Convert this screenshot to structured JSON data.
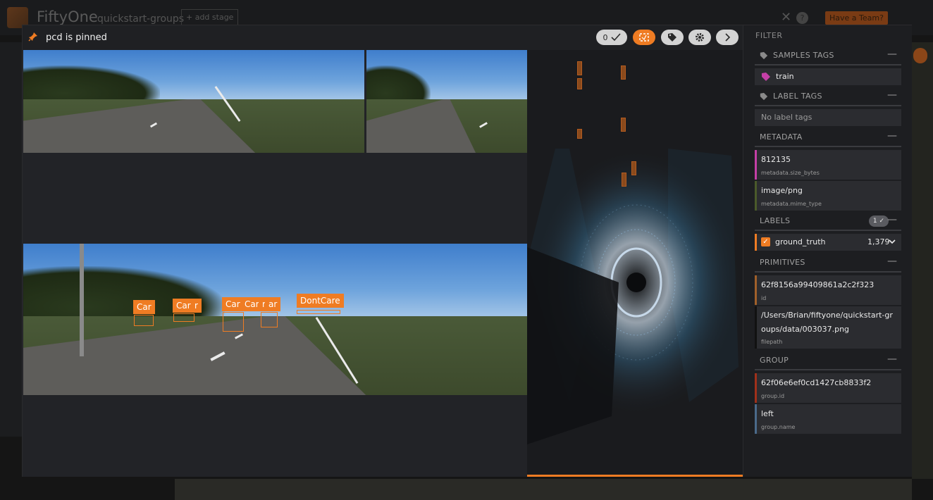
{
  "background_app": {
    "brand": "FiftyOne",
    "dataset": "quickstart-groups",
    "add_stage": "+ add stage",
    "team_button": "Have a Team?"
  },
  "modal": {
    "pinned_title": "pcd is pinned",
    "header_buttons": {
      "count_label": "0",
      "check_icon": "check-icon",
      "crop_icon": "crop-icon",
      "tag_icon": "tag-icon",
      "settings_icon": "gear-icon",
      "next_icon": "chevron-right-icon"
    },
    "annotations": [
      {
        "label": "Car"
      },
      {
        "label": "Car"
      },
      {
        "label": "r"
      },
      {
        "label": "Car"
      },
      {
        "label": "Car"
      },
      {
        "label": "r"
      },
      {
        "label": "ar"
      },
      {
        "label": "DontCare"
      }
    ]
  },
  "sidebar": {
    "filter_label": "FILTER",
    "sections": {
      "samples_tags": "SAMPLES TAGS",
      "label_tags": "LABEL TAGS",
      "metadata": "METADATA",
      "labels": "LABELS",
      "primitives": "PRIMITIVES",
      "group": "GROUP"
    },
    "samples_tags": [
      {
        "name": "train",
        "color": "#c43fa6"
      }
    ],
    "label_tags_empty": "No label tags",
    "metadata": [
      {
        "value": "812135",
        "path": "metadata.size_bytes",
        "color": "#c43fa6"
      },
      {
        "value": "image/png",
        "path": "metadata.mime_type",
        "color": "#4a5a2a"
      }
    ],
    "labels_badge": "1",
    "labels": [
      {
        "name": "ground_truth",
        "count": "1,379",
        "color": "#ef7c23"
      }
    ],
    "primitives": [
      {
        "value": "62f8156a99409861a2c2f323",
        "path": "id",
        "color": "#a0602a"
      },
      {
        "value": "/Users/Brian/fiftyone/quickstart-groups/data/003037.png",
        "path": "filepath",
        "color": "#111111"
      }
    ],
    "group": [
      {
        "value": "62f06e6ef0cd1427cb8833f2",
        "path": "group.id",
        "color": "#a0301a"
      },
      {
        "value": "left",
        "path": "group.name",
        "color": "#4a6a8a"
      }
    ]
  }
}
